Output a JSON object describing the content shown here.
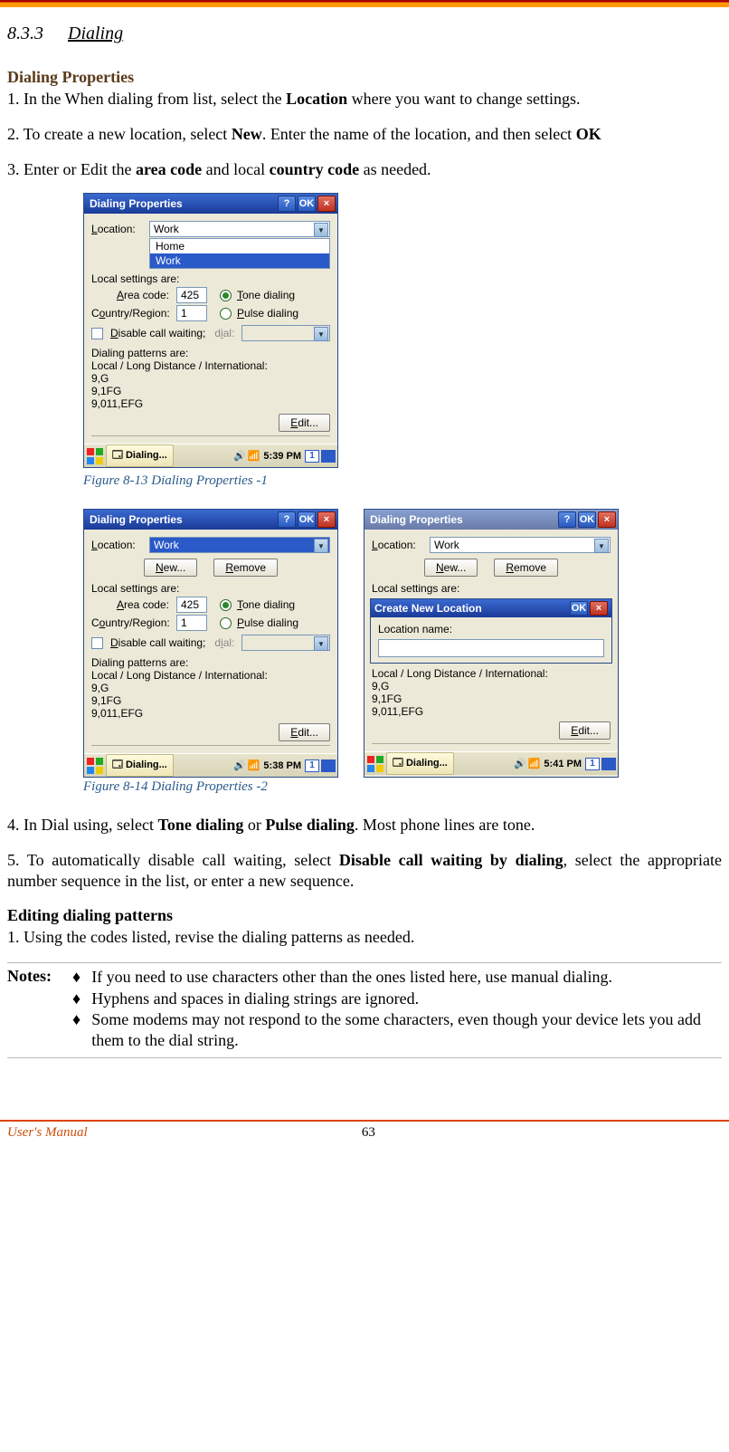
{
  "section": {
    "number": "8.3.3",
    "title": "Dialing"
  },
  "dialing_properties": {
    "heading": "Dialing Properties",
    "step1_a": "1. In the When dialing from list, select the ",
    "step1_b": "Location",
    "step1_c": " where you want to change settings.",
    "step2_a": "2. To create a new location, select ",
    "step2_b": "New",
    "step2_c": ". Enter the name of the location, and then select ",
    "step2_d": "OK",
    "step3_a": "3.  Enter or Edit the ",
    "step3_b": "area code",
    "step3_c": " and local ",
    "step3_d": "country code",
    "step3_e": " as needed.",
    "step4_a": "4. In Dial using, select ",
    "step4_b": "Tone dialing",
    "step4_c": " or ",
    "step4_d": "Pulse dialing",
    "step4_e": ". Most phone lines are tone.",
    "step5_a": "5. To automatically disable call waiting, select ",
    "step5_b": "Disable call waiting by dialing",
    "step5_c": ", select the appropriate number sequence in the list, or enter a new sequence."
  },
  "figcap1": "Figure 8-13 Dialing Properties -1",
  "figcap2": "Figure 8-14 Dialing Properties -2",
  "editing": {
    "heading": "Editing dialing patterns",
    "step1": "1. Using the codes listed, revise the dialing patterns as needed."
  },
  "notes": {
    "label": "Notes:",
    "items": [
      "If you need to use characters other than the ones listed here, use manual dialing.",
      "Hyphens and spaces in dialing strings are ignored.",
      "Some modems may not respond to the some characters, even though your device lets you add them to the dial string."
    ]
  },
  "footer": {
    "manual": "User's Manual",
    "page": "63"
  },
  "win": {
    "title": "Dialing Properties",
    "ok": "OK",
    "help": "?",
    "close": "×",
    "location_lbl": "Location:",
    "location_val": "Work",
    "opt_home": "Home",
    "opt_work": "Work",
    "new": "New...",
    "remove": "Remove",
    "local_settings": "Local settings are:",
    "area_lbl": "Area code:",
    "area_val": "425",
    "country_lbl": "Country/Region:",
    "country_val": "1",
    "tone": "Tone dialing",
    "pulse": "Pulse dialing",
    "disable": "Disable call waiting;",
    "dial": "dial:",
    "patterns_hdr": "Dialing patterns are:",
    "patterns_sub": "Local / Long Distance / International:",
    "p1": "9,G",
    "p2": "9,1FG",
    "p3": "9,011,EFG",
    "edit": "Edit...",
    "task_dialing": "Dialing...",
    "time1": "5:39 PM",
    "time2": "5:38 PM",
    "time3": "5:41 PM",
    "kbd": "1",
    "cnl_title": "Create New Location",
    "cnl_lbl": "Location name:",
    "cnl_val": ""
  }
}
